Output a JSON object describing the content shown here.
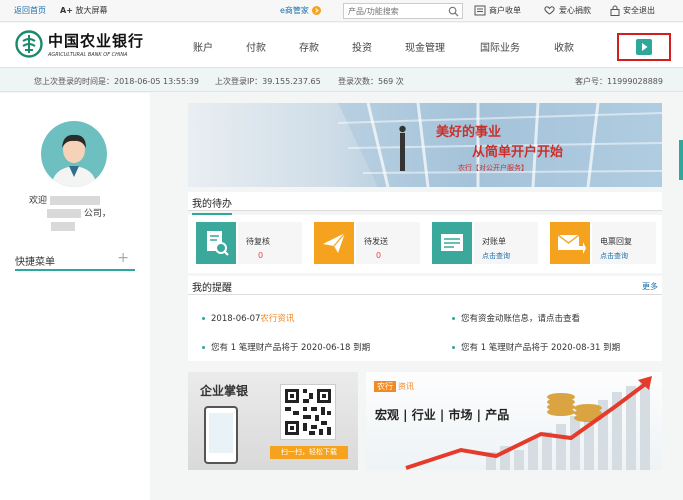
{
  "topbar": {
    "back_home": "返回首页",
    "zoom_label": "放大屏幕",
    "zoom_prefix": "A+",
    "emanager": "e商管家",
    "search_placeholder": "产品/功能搜索",
    "merchant": "商户收单",
    "donate": "爱心捐款",
    "logout": "安全退出"
  },
  "header": {
    "bank_name_cn": "中国农业银行",
    "bank_name_en": "AGRICULTURAL BANK OF CHINA",
    "nav": [
      "账户",
      "付款",
      "存款",
      "投资",
      "现金管理",
      "国际业务",
      "收款"
    ]
  },
  "infobar": {
    "last_login_time": "您上次登录的时间是：2018-06-05 13:55:39",
    "last_login_ip": "上次登录IP：39.155.237.65",
    "login_count": "登录次数：569 次",
    "customer_no": "客户号：11999028889"
  },
  "left": {
    "welcome_prefix": "欢迎",
    "welcome_suffix": "公司，",
    "quick_menu": "快捷菜单",
    "plus": "+"
  },
  "banner": {
    "line1": "美好的事业",
    "line2": "从简单开户开始",
    "line3": "农行【对公开户服务】"
  },
  "todo": {
    "title": "我的待办",
    "items": [
      {
        "label": "待复核",
        "value": "0"
      },
      {
        "label": "待发送",
        "value": "0"
      },
      {
        "label": "对账单",
        "link": "点击查询"
      },
      {
        "label": "电票回复",
        "link": "点击查询"
      }
    ]
  },
  "reminders": {
    "title": "我的提醒",
    "more": "更多",
    "r1_date": "2018-06-07",
    "r1_link": "农行资讯",
    "r2": "您有资金动账信息，请点击查看",
    "r3": "您有 1 笔理财产品将于 2020-06-18 到期",
    "r4": "您有 1 笔理财产品将于 2020-08-31 到期"
  },
  "cards": {
    "mobile_bank": "企业掌银",
    "scan_label": "扫一扫，轻松下载",
    "news_tag_a": "农行",
    "news_tag_b": "资讯",
    "news_big": "宏观 | 行业 | 市场 | 产品"
  },
  "colors": {
    "brand": "#2ea89d",
    "accent_orange": "#f5a31e",
    "alert_red": "#e24848",
    "highlight_box": "#d21e1e"
  }
}
